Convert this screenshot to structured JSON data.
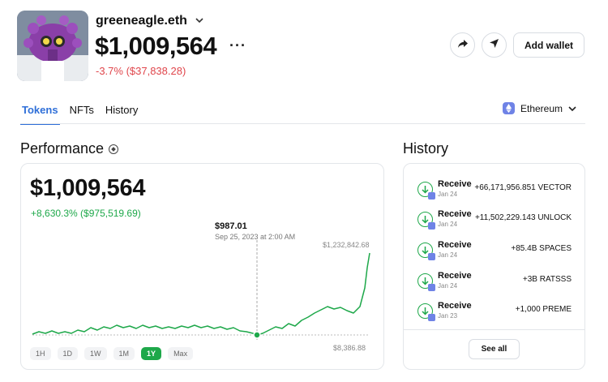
{
  "header": {
    "wallet_name": "greeneagle.eth",
    "balance": "$1,009,564",
    "change": "-3.7% ($37,838.28)",
    "more_label": "···",
    "add_wallet_label": "Add wallet"
  },
  "tabs": [
    {
      "label": "Tokens",
      "active": true
    },
    {
      "label": "NFTs",
      "active": false
    },
    {
      "label": "History",
      "active": false
    }
  ],
  "network": {
    "label": "Ethereum"
  },
  "performance": {
    "title": "Performance",
    "value": "$1,009,564",
    "change": "+8,630.3% ($975,519.69)",
    "tooltip_value": "$987.01",
    "tooltip_date": "Sep 25, 2023 at 2:00 AM",
    "max_label": "$1,232,842.68",
    "min_label": "$8,386.88",
    "ranges": [
      {
        "label": "1H",
        "active": false
      },
      {
        "label": "1D",
        "active": false
      },
      {
        "label": "1W",
        "active": false
      },
      {
        "label": "1M",
        "active": false
      },
      {
        "label": "1Y",
        "active": true
      },
      {
        "label": "Max",
        "active": false
      }
    ]
  },
  "history": {
    "title": "History",
    "items": [
      {
        "type": "Receive",
        "date": "Jan 24",
        "amount": "+66,171,956.851 VECTOR"
      },
      {
        "type": "Receive",
        "date": "Jan 24",
        "amount": "+11,502,229.143 UNLOCK"
      },
      {
        "type": "Receive",
        "date": "Jan 24",
        "amount": "+85.4B SPACES"
      },
      {
        "type": "Receive",
        "date": "Jan 24",
        "amount": "+3B RATSSS"
      },
      {
        "type": "Receive",
        "date": "Jan 23",
        "amount": "+1,000 PREME"
      }
    ],
    "see_all_label": "See all"
  },
  "colors": {
    "accent": "#2f6fd8",
    "positive": "#1ea84a",
    "negative": "#e0464c",
    "ethereum": "#6f83e6"
  }
}
